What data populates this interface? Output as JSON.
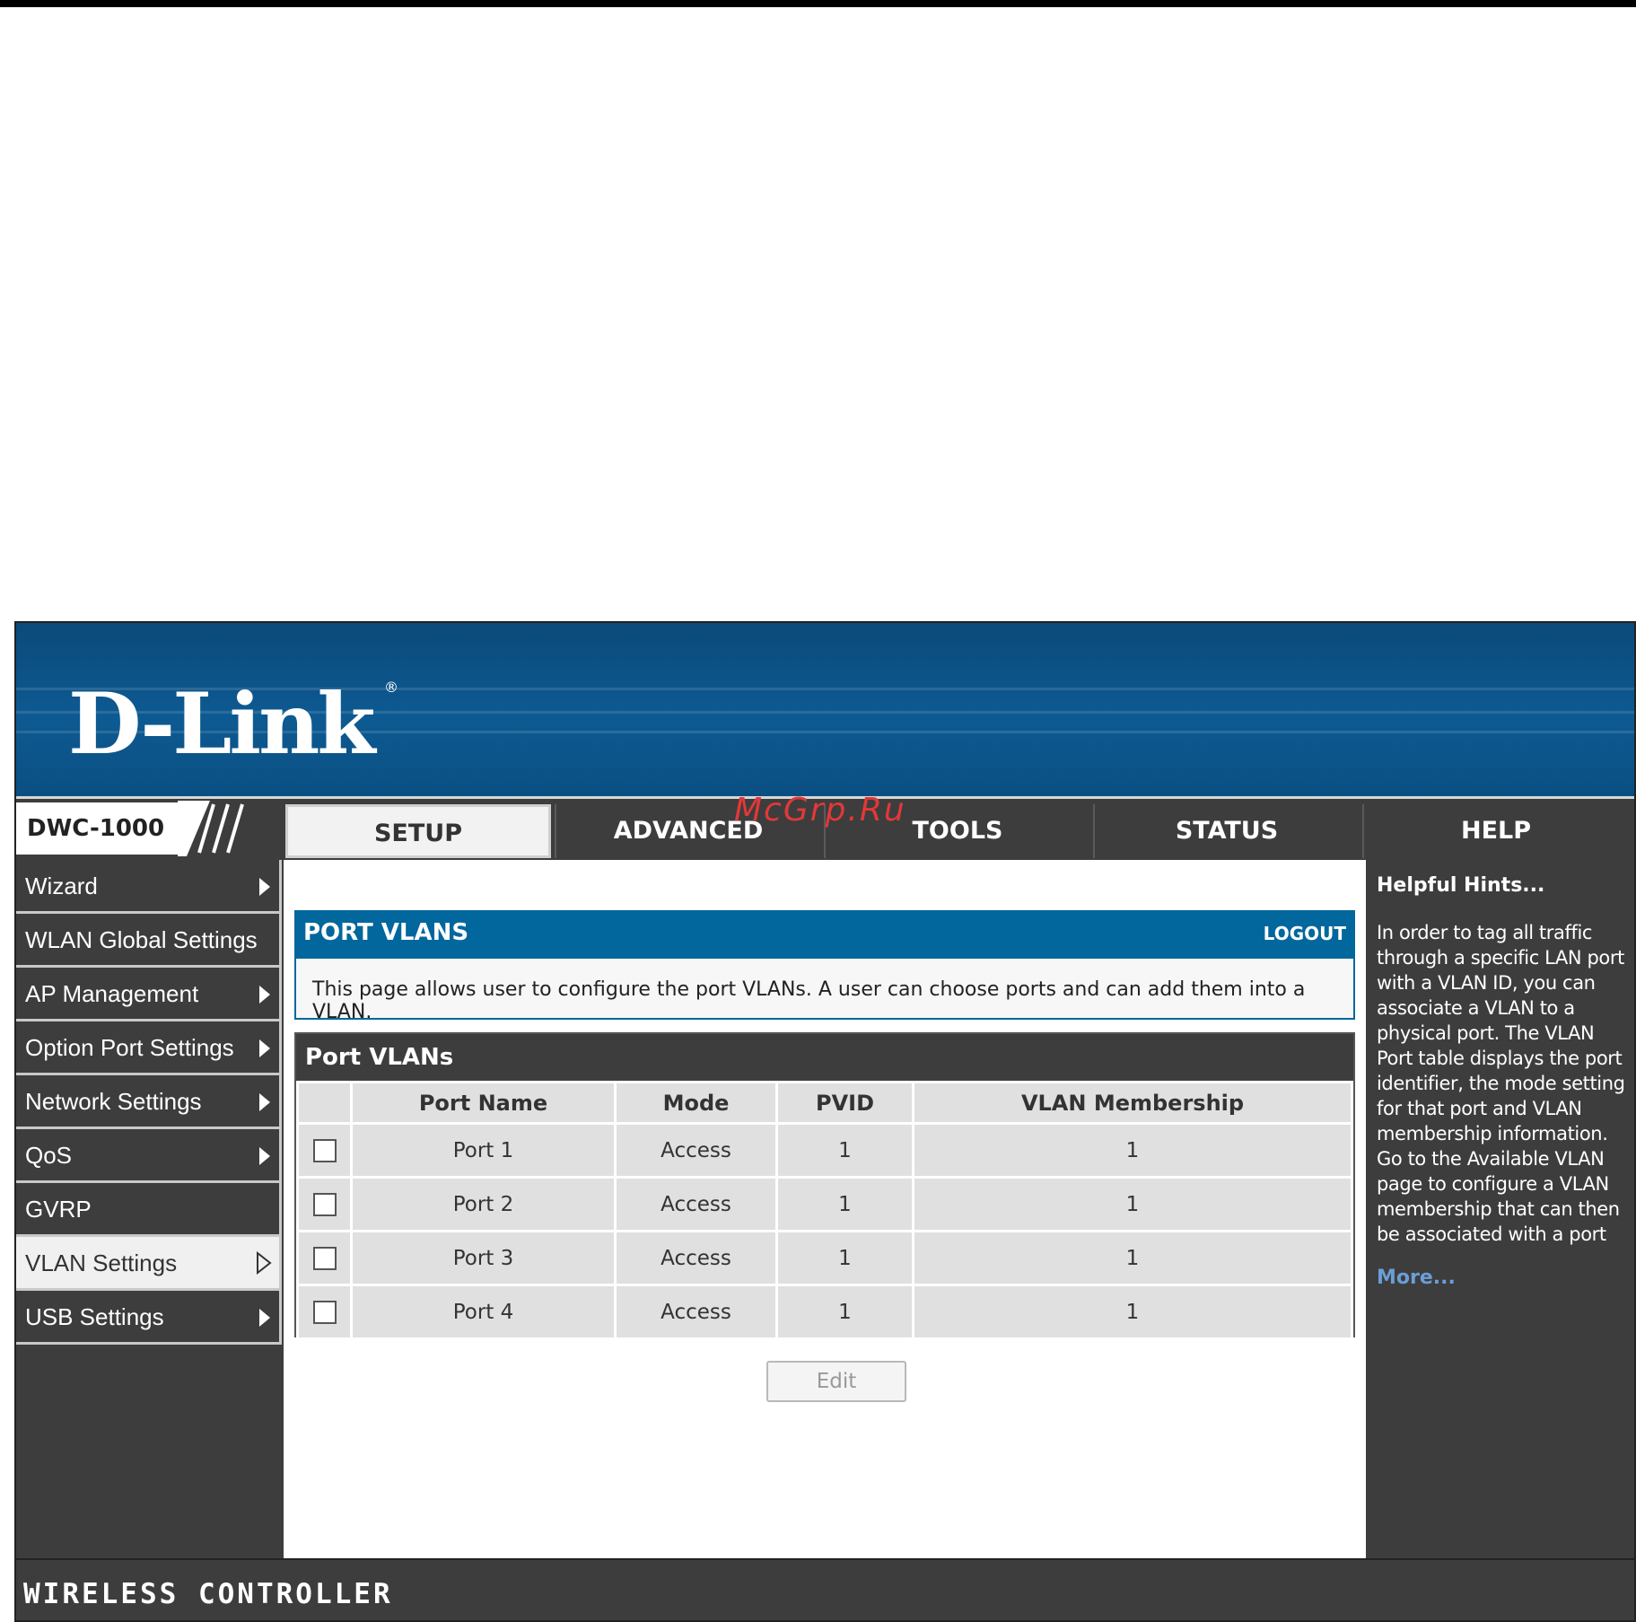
{
  "brand": {
    "logo": "D-Link",
    "registered": "®",
    "model": "DWC-1000"
  },
  "tabs": [
    {
      "label": "SETUP",
      "active": true
    },
    {
      "label": "ADVANCED",
      "active": false
    },
    {
      "label": "TOOLS",
      "active": false
    },
    {
      "label": "STATUS",
      "active": false
    },
    {
      "label": "HELP",
      "active": false
    }
  ],
  "menu": [
    {
      "label": "Wizard",
      "arrow": "right-arrow-icon"
    },
    {
      "label": "WLAN Global Settings",
      "arrow": ""
    },
    {
      "label": "AP Management",
      "arrow": "right-arrow-icon"
    },
    {
      "label": "Option Port Settings",
      "arrow": "right-arrow-icon"
    },
    {
      "label": "Network Settings",
      "arrow": "right-arrow-icon"
    },
    {
      "label": "QoS",
      "arrow": "right-arrow-icon"
    },
    {
      "label": "GVRP",
      "arrow": ""
    },
    {
      "label": "VLAN Settings",
      "arrow": "open-arrow-icon",
      "active": true
    },
    {
      "label": "USB Settings",
      "arrow": "right-arrow-icon"
    }
  ],
  "page": {
    "title": "PORT VLANS",
    "logout": "LOGOUT",
    "description": "This page allows user to configure the port VLANs. A user can choose ports and can add them into a VLAN."
  },
  "table": {
    "title": "Port VLANs",
    "columns": [
      "Port Name",
      "Mode",
      "PVID",
      "VLAN Membership"
    ],
    "rows": [
      [
        "Port 1",
        "Access",
        "1",
        "1"
      ],
      [
        "Port 2",
        "Access",
        "1",
        "1"
      ],
      [
        "Port 3",
        "Access",
        "1",
        "1"
      ],
      [
        "Port 4",
        "Access",
        "1",
        "1"
      ]
    ],
    "edit_label": "Edit"
  },
  "help": {
    "title": "Helpful Hints...",
    "text": "In order to tag all traffic through a specific LAN port with a VLAN ID, you can associate a VLAN to a physical port. The VLAN Port table displays the port identifier, the mode setting for that port and VLAN membership information. Go to the Available VLAN page to configure a VLAN membership that can then be associated with a port",
    "more": "More..."
  },
  "footer": {
    "text": "WIRELESS CONTROLLER"
  },
  "watermark": "McGrp.Ru",
  "colors": {
    "banner": "#0d5a92",
    "header_blue": "#02679c",
    "dark": "#3d3d3d",
    "link": "#6b9ed6"
  }
}
